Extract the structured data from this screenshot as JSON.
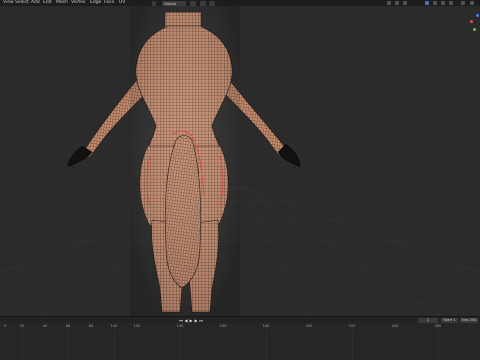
{
  "menubar": {
    "items": [
      "View",
      "Select",
      "Add",
      "Edit",
      "Mesh",
      "Vertex",
      "Edge",
      "Face",
      "UV"
    ]
  },
  "header": {
    "transform_orientation": "Global"
  },
  "timeline": {
    "current_frame": "1",
    "start_label": "Start",
    "start_value": "1",
    "end_label": "End",
    "end_value": "250",
    "ticks": [
      "0",
      "20",
      "40",
      "60",
      "80",
      "100",
      "120",
      "140",
      "160",
      "180",
      "200",
      "220",
      "240",
      "260"
    ]
  },
  "colors": {
    "background": "#2b2b2b",
    "menubar": "#1d1d1d",
    "mesh_face": "#c99072",
    "mesh_wire": "#1a0f0a",
    "seam": "#e03c3c",
    "accent": "#4772b3"
  },
  "icons": [
    "gizmo-x-dot",
    "gizmo-y-dot",
    "gizmo-z-dot",
    "play-icon",
    "jump-start-icon",
    "jump-end-icon",
    "keyframe-prev-icon",
    "keyframe-next-icon"
  ]
}
